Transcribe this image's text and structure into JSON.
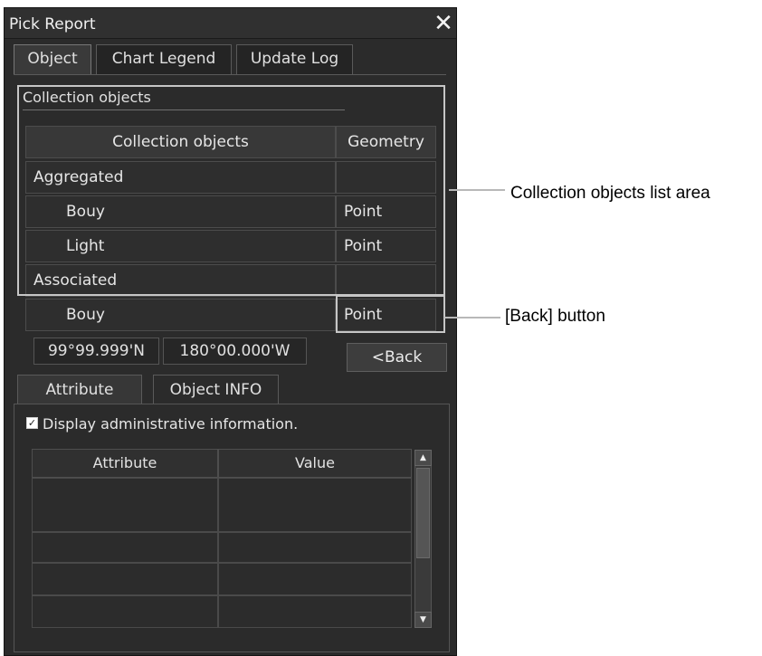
{
  "window": {
    "title": "Pick Report",
    "close_glyph": "✕",
    "close_icon": "close-icon"
  },
  "tabs": [
    {
      "label": "Object",
      "active": true
    },
    {
      "label": "Chart Legend",
      "active": false
    },
    {
      "label": "Update Log",
      "active": false
    }
  ],
  "collection": {
    "group_label": "Collection objects",
    "headers": [
      "Collection objects",
      "Geometry"
    ],
    "rows": [
      {
        "name": "Aggregated",
        "geometry": "",
        "indent": false
      },
      {
        "name": "Bouy",
        "geometry": "Point",
        "indent": true
      },
      {
        "name": "Light",
        "geometry": "Point",
        "indent": true
      },
      {
        "name": "Associated",
        "geometry": "",
        "indent": false
      },
      {
        "name": "Bouy",
        "geometry": "Point",
        "indent": true
      }
    ]
  },
  "position": {
    "lat": "99°99.999'N",
    "lon": "180°00.000'W"
  },
  "back_button": {
    "label": "<Back"
  },
  "subtabs": [
    {
      "label": "Attribute",
      "active": true
    },
    {
      "label": "Object INFO",
      "active": false
    }
  ],
  "admin_checkbox": {
    "label": "Display administrative information.",
    "checked": true,
    "check_glyph": "✓"
  },
  "attribute_table": {
    "headers": [
      "Attribute",
      "Value"
    ],
    "row_count": 5
  },
  "scrollbar": {
    "up_glyph": "▲",
    "down_glyph": "▼"
  },
  "callouts": {
    "list_area": "Collection objects list area",
    "back_button": "[Back] button"
  },
  "colors": {
    "panel_bg": "#2b2b2b",
    "highlight_border": "#c6c6c6",
    "text": "#e8e8e8"
  }
}
